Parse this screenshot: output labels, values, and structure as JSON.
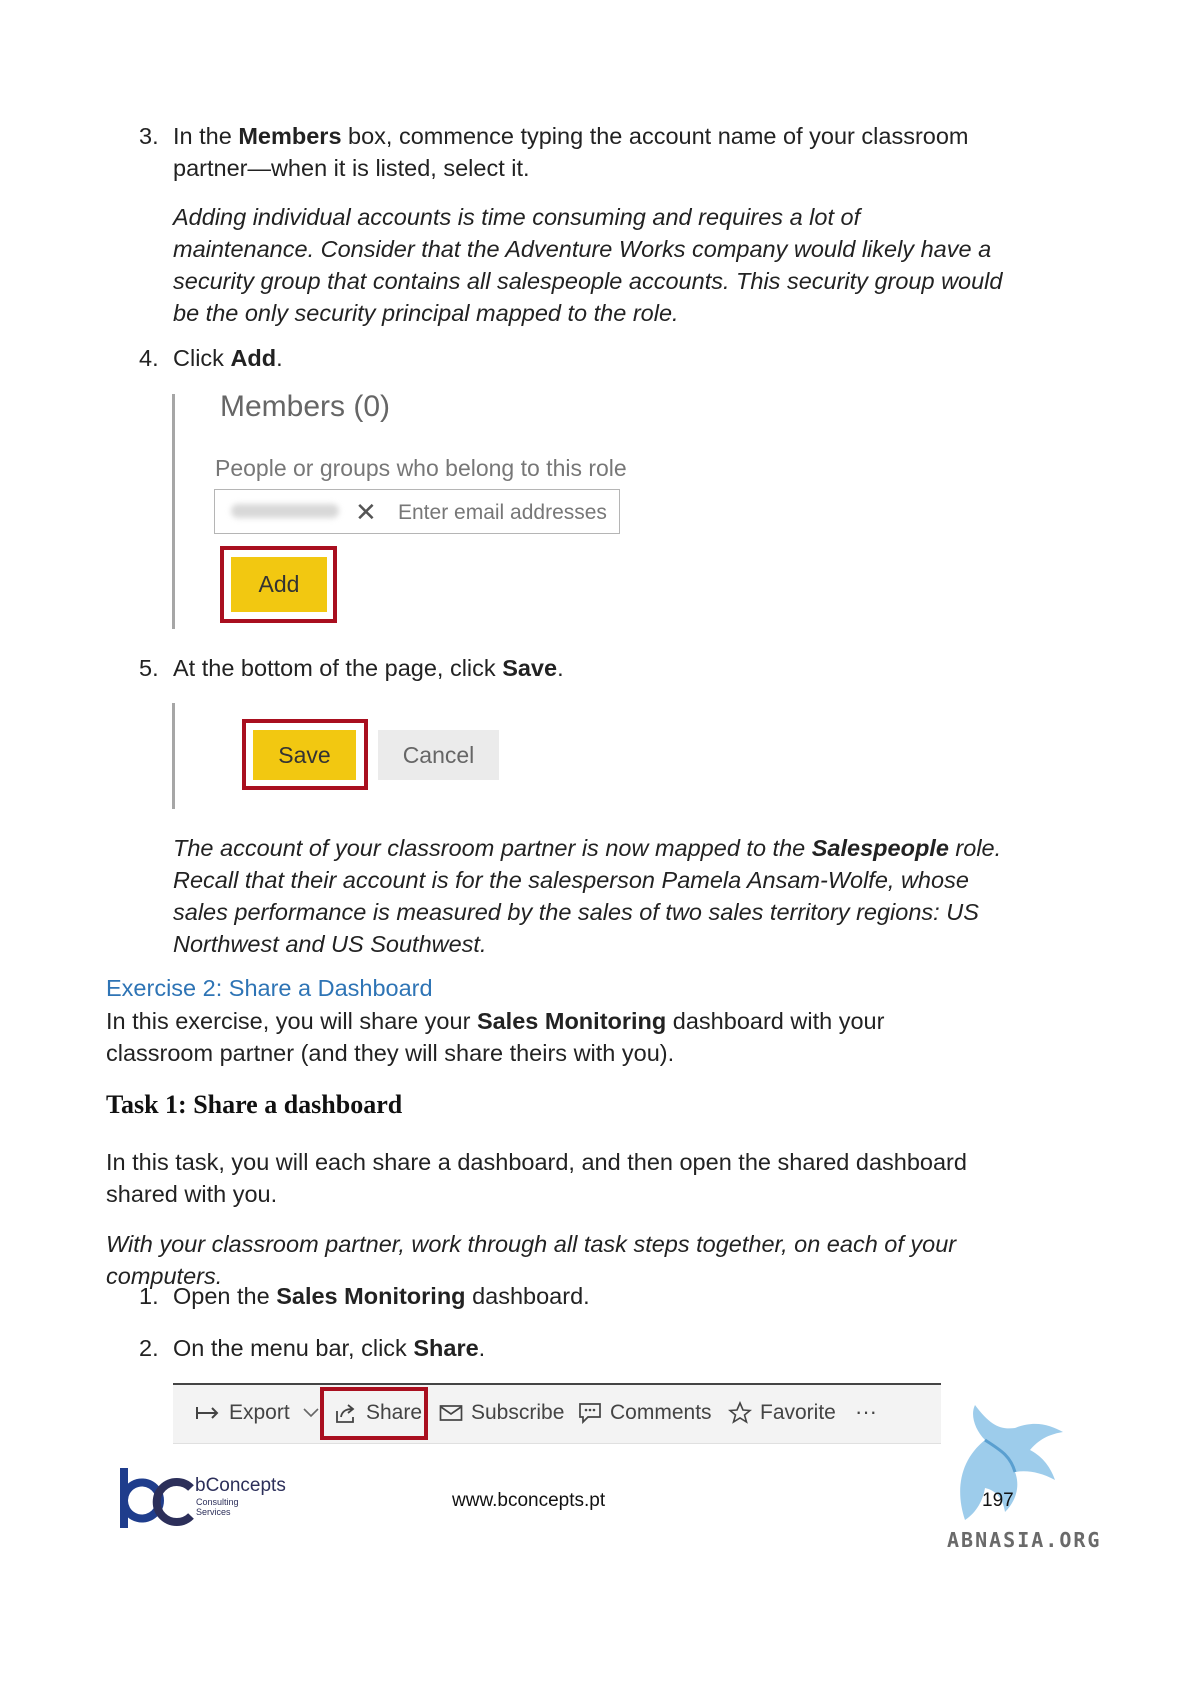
{
  "steps": {
    "s3": {
      "num": "3.",
      "pre": "In the ",
      "bold": "Members",
      "post": " box, commence typing the account name of your classroom partner—when it is listed, select it."
    },
    "note1": "Adding individual accounts is time consuming and requires a lot of maintenance. Consider that the Adventure Works company would likely have a security group that contains all salespeople accounts. This security group would be the only security principal mapped to the role.",
    "s4": {
      "num": "4.",
      "pre": "Click ",
      "bold": "Add",
      "post": "."
    },
    "s5": {
      "num": "5.",
      "pre": "At the bottom of the page, click ",
      "bold": "Save",
      "post": "."
    },
    "note2": {
      "pre": "The account of your classroom partner is now mapped to the ",
      "bold": "Salespeople",
      "post": " role. Recall that their account is for the salesperson Pamela Ansam-Wolfe, whose sales performance is measured by the sales of two sales territory regions: US Northwest and US Southwest."
    }
  },
  "members_panel": {
    "title": "Members (0)",
    "subtitle": "People or groups who belong to this role",
    "email_placeholder": "Enter email addresses",
    "remove_glyph": "✕",
    "add_label": "Add"
  },
  "save_panel": {
    "save_label": "Save",
    "cancel_label": "Cancel"
  },
  "exercise": {
    "heading": "Exercise 2: Share a Dashboard",
    "intro_pre": "In this exercise, you will share your ",
    "intro_bold": "Sales Monitoring",
    "intro_post": " dashboard with your classroom partner (and they will share theirs with you)."
  },
  "task": {
    "title": "Task 1: Share a dashboard",
    "intro": "In this task, you will each share a dashboard, and then open the shared dashboard shared with you.",
    "note": "With your classroom partner, work through all task steps together, on each of your computers.",
    "t1": {
      "num": "1.",
      "pre": "Open the ",
      "bold": "Sales Monitoring",
      "post": " dashboard."
    },
    "t2": {
      "num": "2.",
      "pre": "On the menu bar, click ",
      "bold": "Share",
      "post": "."
    }
  },
  "toolbar": {
    "export": "Export",
    "share": "Share",
    "subscribe": "Subscribe",
    "comments": "Comments",
    "favorite": "Favorite",
    "more": "···"
  },
  "footer": {
    "brand": "bConcepts",
    "brand_sub1": "Consulting",
    "brand_sub2": "Services",
    "url": "www.bconcepts.pt",
    "page": "197",
    "watermark": "ABNASIA.ORG"
  },
  "colors": {
    "highlight": "#a90f1f",
    "button_yellow": "#f2c811",
    "heading_blue": "#2e74b5",
    "logo_blue": "#1f3d8c",
    "logo_dark": "#2c2f5a"
  }
}
